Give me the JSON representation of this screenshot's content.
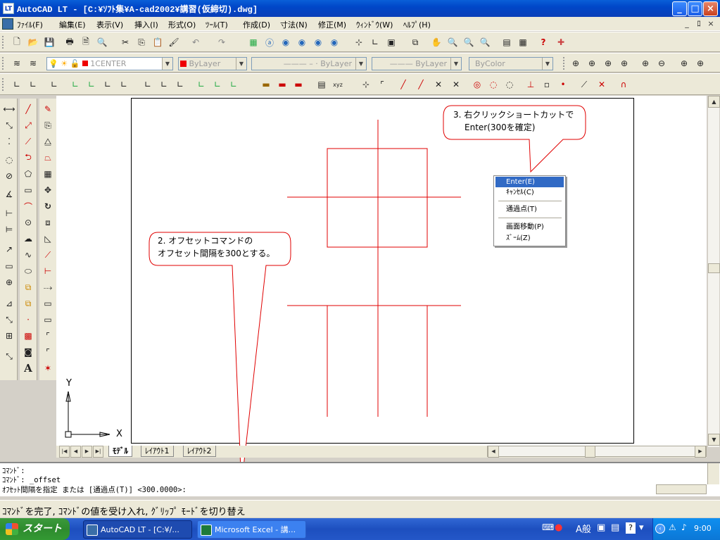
{
  "window": {
    "title": "AutoCAD LT - [C:¥ｿﾌﾄ集¥A-cad2002¥講習(仮締切).dwg]",
    "app_icon_label": "LT",
    "btn_minimize": "_",
    "btn_maximize": "□",
    "btn_close": "×"
  },
  "menubar": {
    "items": [
      "ﾌｧｲﾙ(F)",
      "編集(E)",
      "表示(V)",
      "挿入(I)",
      "形式(O)",
      "ﾂｰﾙ(T)",
      "作成(D)",
      "寸法(N)",
      "修正(M)",
      "ｳｨﾝﾄﾞｳ(W)",
      "ﾍﾙﾌﾟ(H)"
    ],
    "mdi_min": "_",
    "mdi_restore": "ﾛ",
    "mdi_close": "×"
  },
  "layers": {
    "layer_combo": "1CENTER",
    "color_combo": "ByLayer",
    "linetype_combo": "ByLayer",
    "lineweight_combo": "ByLayer",
    "plotstyle_combo": "ByColor"
  },
  "context_menu": {
    "items": [
      "Enter(E)",
      "ｷｬﾝｾﾙ(C)",
      "通過点(T)",
      "画面移動(P)",
      "ｽﾞｰﾑ(Z)"
    ]
  },
  "callouts": {
    "offset_line1": "2. オフセットコマンドの",
    "offset_line2": "オフセット間隔を300とする。",
    "rightclick_line1": "3. 右クリックショートカットで",
    "rightclick_line2": "Enter(300を確定)"
  },
  "ucs": {
    "x_label": "X",
    "y_label": "Y"
  },
  "layout_tabs": [
    "ﾓﾃﾞﾙ",
    "ﾚｲｱｳﾄ1",
    "ﾚｲｱｳﾄ2"
  ],
  "nav_first": "|◀",
  "nav_prev": "◀",
  "nav_next": "▶",
  "nav_last": "▶|",
  "command": {
    "line1": "ｺﾏﾝﾄﾞ:",
    "line2": "ｺﾏﾝﾄﾞ: _offset",
    "prompt": "ｵﾌｾｯﾄ間隔を指定 または [通過点(T)] <300.0000>:"
  },
  "status": {
    "text": "ｺﾏﾝﾄﾞを完了, ｺﾏﾝﾄﾞの値を受け入れ, ｸﾞﾘｯﾌﾟ ﾓｰﾄﾞを切り替え"
  },
  "taskbar": {
    "start": "スタート",
    "buttons": [
      "AutoCAD LT - [C:¥/...",
      "Microsoft Excel - 講..."
    ],
    "ime_text": "A般",
    "clock": "9:00"
  },
  "colors": {
    "drawing_line": "#e00000",
    "callout_border": "#e00000",
    "menu_highlight": "#316ac5"
  }
}
